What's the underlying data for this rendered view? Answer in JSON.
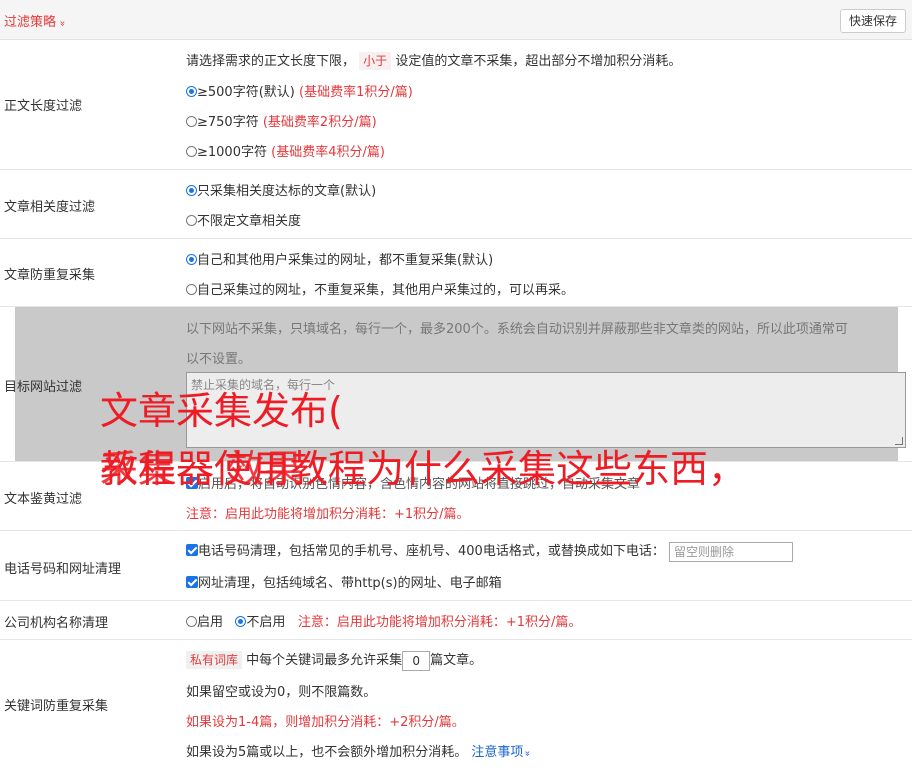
{
  "header": {
    "title": "过滤策略",
    "chevron": "»",
    "save_label": "快速保存"
  },
  "length_filter": {
    "label": "正文长度过滤",
    "desc_before": "请选择需求的正文长度下限，",
    "desc_tag": "小于",
    "desc_after": "设定值的文章不采集，超出部分不增加积分消耗。",
    "options": [
      {
        "text": "≥500字符(默认)",
        "note": "(基础费率1积分/篇)",
        "selected": true
      },
      {
        "text": "≥750字符",
        "note": "(基础费率2积分/篇)",
        "selected": false
      },
      {
        "text": "≥1000字符",
        "note": "(基础费率4积分/篇)",
        "selected": false
      }
    ]
  },
  "relevance_filter": {
    "label": "文章相关度过滤",
    "options": [
      {
        "text": "只采集相关度达标的文章(默认)",
        "selected": true
      },
      {
        "text": "不限定文章相关度",
        "selected": false
      }
    ]
  },
  "dedupe": {
    "label": "文章防重复采集",
    "options": [
      {
        "text": "自己和其他用户采集过的网址，都不重复采集(默认)",
        "selected": true
      },
      {
        "text": "自己采集过的网址，不重复采集，其他用户采集过的，可以再采。",
        "selected": false
      }
    ]
  },
  "site_filter": {
    "label": "目标网站过滤",
    "desc_line1": "以下网站不采集，只填域名，每行一个，最多200个。系统会自动识别并屏蔽那些非文章类的网站，所以此项通常可",
    "desc_line2": "以不设置。",
    "placeholder": "禁止采集的域名，每行一个"
  },
  "porn_filter": {
    "label": "文本鉴黄过滤",
    "hidden_text": "启用后，将自动识别色情内容，含色情内容的网站将直接跳过，自动采集文章",
    "note": "注意：启用此功能将增加积分消耗：+1积分/篇。"
  },
  "contact_clean": {
    "label": "电话号码和网址清理",
    "phone_text": "电话号码清理，包括常见的手机号、座机号、400电话格式，或替换成如下电话：",
    "phone_placeholder": "留空则删除",
    "url_text": "网址清理，包括纯域名、带http(s)的网址、电子邮箱"
  },
  "company_clean": {
    "label": "公司机构名称清理",
    "opt_on": "启用",
    "opt_off": "不启用",
    "note": "注意：启用此功能将增加积分消耗：+1积分/篇。"
  },
  "keyword_dedupe": {
    "label": "关键词防重复采集",
    "tag": "私有词库",
    "line1_mid": "中每个关键词最多允许采集",
    "count_value": "0",
    "line1_end": "篇文章。",
    "line2": "如果留空或设为0，则不限篇数。",
    "line3": "如果设为1-4篇，则增加积分消耗：+2积分/篇。",
    "line4": "如果设为5篇或以上，也不会额外增加积分消耗。",
    "notes_link": "注意事项",
    "notes_caret": "»"
  },
  "overlay": {
    "line1": "文章采集发布(",
    "line2a": "教程器使用教程为什么采集这些东西，",
    "line2b": "采集器 效果"
  }
}
